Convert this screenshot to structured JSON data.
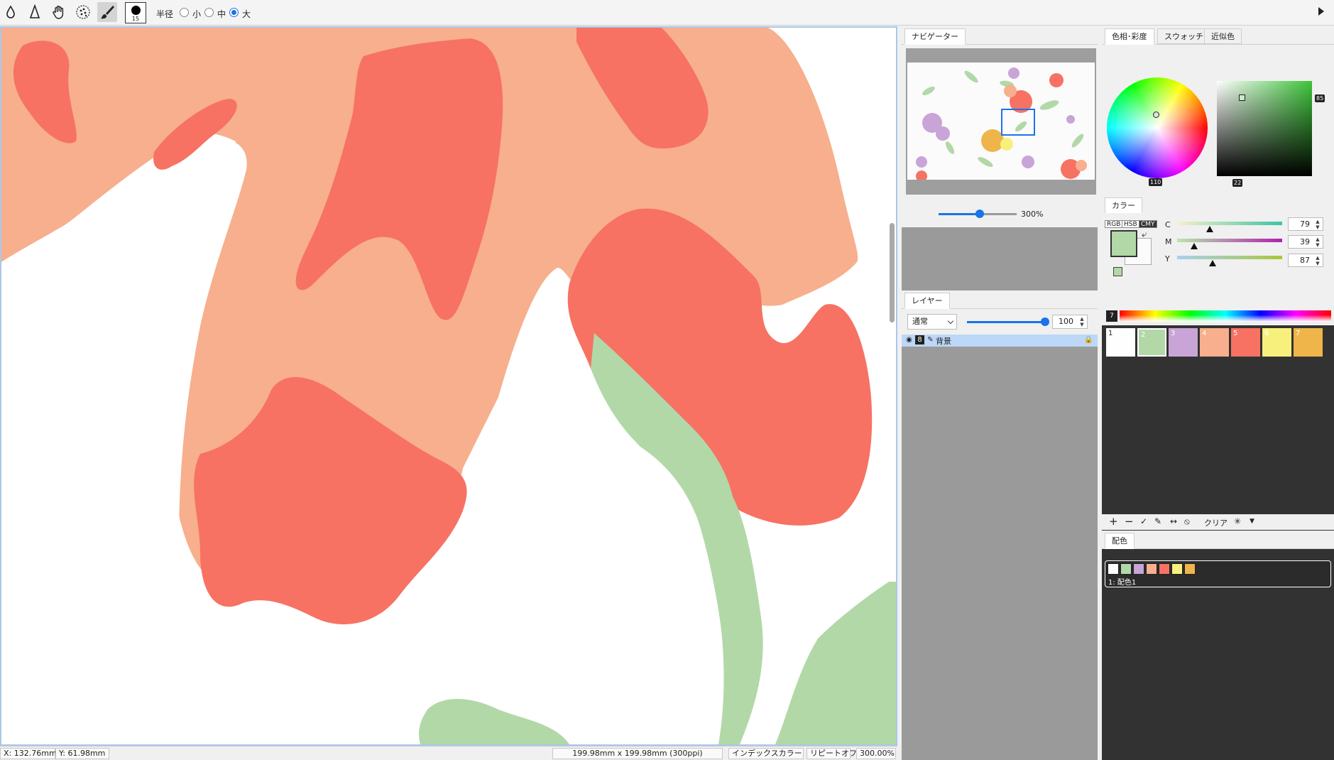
{
  "toolbar": {
    "tools": [
      "eyedropper-icon",
      "pen-icon",
      "hand-icon",
      "airbrush-icon",
      "brush-icon"
    ],
    "brush_size": "15",
    "radius_label": "半径",
    "radius_options": [
      "小",
      "中",
      "大"
    ],
    "radius_selected": "大"
  },
  "status": {
    "x": "X:  132.76mm",
    "y": "Y:   61.98mm",
    "size": "199.98mm x 199.98mm (300ppi)",
    "mode": "インデックスカラー",
    "repeat": "リピートオフ",
    "zoom": "300.00%"
  },
  "navigator": {
    "tab": "ナビゲーター",
    "zoom": "300%",
    "zoom_level": 0.53
  },
  "layers": {
    "tab": "レイヤー",
    "blend_mode": "通常",
    "opacity": "100",
    "items": [
      {
        "name": "背景",
        "selected": true
      }
    ]
  },
  "color_panel": {
    "tabs": [
      "色相･彩度",
      "スウォッチ",
      "近似色"
    ],
    "active_tab": "色相･彩度",
    "hue": "110",
    "saturation": "22",
    "brightness": "85",
    "hsv_tab": "カラー",
    "modes": [
      "RGB",
      "HSB",
      "CMY"
    ],
    "active_mode": "CMY",
    "sliders": [
      {
        "label": "C",
        "value": "79"
      },
      {
        "label": "M",
        "value": "39"
      },
      {
        "label": "Y",
        "value": "87"
      }
    ],
    "foreground": "#b2d8a8",
    "background": "#fbfbfb"
  },
  "swatches": {
    "number": "7",
    "items": [
      {
        "label": "1",
        "color": "#fefefe"
      },
      {
        "label": "2",
        "color": "#b2d8a8"
      },
      {
        "label": "3",
        "color": "#c9a4d7"
      },
      {
        "label": "4",
        "color": "#f7af8d"
      },
      {
        "label": "5",
        "color": "#f77263"
      },
      {
        "label": "6",
        "color": "#f7f07c"
      },
      {
        "label": "7",
        "color": "#efb54a"
      }
    ],
    "selected": "2",
    "toolbar_clear": "クリア"
  },
  "schemes": {
    "tab": "配色",
    "items": [
      {
        "name": "1: 配色1",
        "colors": [
          "#fefefe",
          "#b2d8a8",
          "#c9a4d7",
          "#f7af8d",
          "#f77263",
          "#f7f07c",
          "#efb54a"
        ]
      }
    ]
  }
}
